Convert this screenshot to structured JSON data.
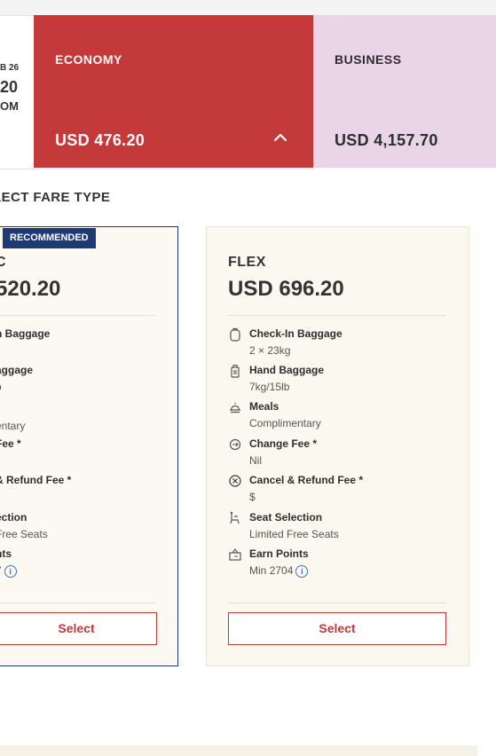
{
  "date_card": {
    "top": "B 26",
    "price": "20",
    "sub": "OM"
  },
  "cabins": {
    "economy": {
      "label": "ECONOMY",
      "price": "USD 476.20"
    },
    "business": {
      "label": "BUSINESS",
      "price": "USD 4,157.70"
    }
  },
  "section_title": "LECT FARE TYPE",
  "fares": {
    "left": {
      "badge": "RECOMMENDED",
      "name": "C",
      "price": "520.20",
      "features": [
        {
          "title": "n Baggage",
          "value": ""
        },
        {
          "title": "aggage",
          "value": "b"
        },
        {
          "title": "",
          "value": "entary"
        },
        {
          "title": "Fee *",
          "value": ""
        },
        {
          "title": "& Refund Fee *",
          "value": ""
        },
        {
          "title": "ection",
          "value": "Free Seats"
        },
        {
          "title": "nts",
          "value": "7"
        }
      ],
      "select_label": "Select"
    },
    "right": {
      "name": "FLEX",
      "price": "USD 696.20",
      "features": [
        {
          "icon": "checkin-baggage-icon",
          "title": "Check-In Baggage",
          "value": "2 × 23kg"
        },
        {
          "icon": "hand-baggage-icon",
          "title": "Hand Baggage",
          "value": "7kg/15lb"
        },
        {
          "icon": "meals-icon",
          "title": "Meals",
          "value": "Complimentary"
        },
        {
          "icon": "change-fee-icon",
          "title": "Change Fee *",
          "value": "Nil"
        },
        {
          "icon": "cancel-refund-icon",
          "title": "Cancel & Refund Fee *",
          "value": "$"
        },
        {
          "icon": "seat-selection-icon",
          "title": "Seat Selection",
          "value": "Limited Free Seats"
        },
        {
          "icon": "earn-points-icon",
          "title": "Earn Points",
          "value": "Min 2704"
        }
      ],
      "select_label": "Select"
    }
  },
  "colors": {
    "economy_bg": "#c43a3a",
    "business_bg": "#ead4e8",
    "recommended": "#1e3a74",
    "select_border": "#c43a3a"
  },
  "info_icon": "i"
}
